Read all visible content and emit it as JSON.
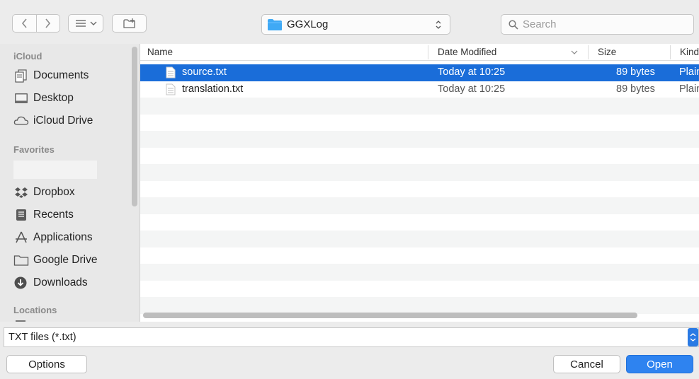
{
  "toolbar": {
    "location": "GGXLog",
    "search_placeholder": "Search"
  },
  "sidebar": {
    "sections": [
      {
        "heading": "iCloud"
      },
      {
        "heading": "Favorites"
      },
      {
        "heading": "Locations"
      }
    ],
    "icloud_items": [
      "Documents",
      "Desktop",
      "iCloud Drive"
    ],
    "favorite_items": [
      "Dropbox",
      "Recents",
      "Applications",
      "Google Drive",
      "Downloads"
    ]
  },
  "columns": {
    "name": "Name",
    "date": "Date Modified",
    "size": "Size",
    "kind": "Kind"
  },
  "files": [
    {
      "name": "source.txt",
      "date": "Today at 10:25",
      "size": "89 bytes",
      "kind": "Plain",
      "selected": true
    },
    {
      "name": "translation.txt",
      "date": "Today at 10:25",
      "size": "89 bytes",
      "kind": "Plain",
      "selected": false
    }
  ],
  "filetype": {
    "selected": "TXT files (*.txt)"
  },
  "buttons": {
    "options": "Options",
    "cancel": "Cancel",
    "open": "Open"
  },
  "colors": {
    "selection": "#1a6dd9",
    "accent": "#2e83f0",
    "folder": "#3fa9f5"
  }
}
